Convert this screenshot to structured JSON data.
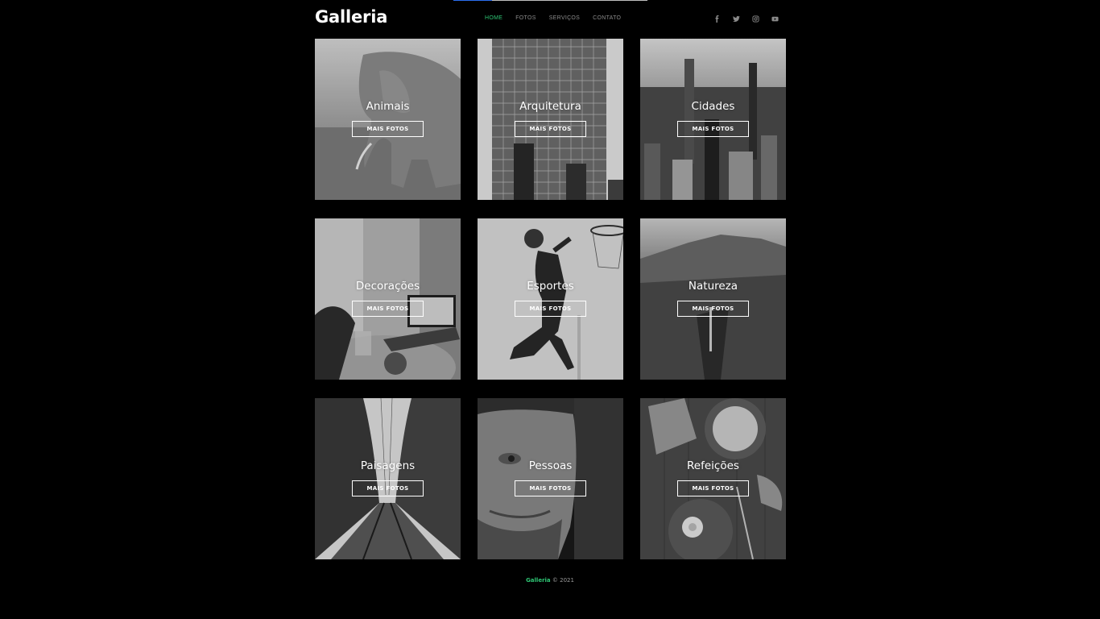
{
  "loading": {
    "progress": 0.2
  },
  "header": {
    "logo": "Galleria",
    "nav": [
      {
        "label": "HOME",
        "active": true
      },
      {
        "label": "FOTOS",
        "active": false
      },
      {
        "label": "SERVIÇOS",
        "active": false
      },
      {
        "label": "CONTATO",
        "active": false
      }
    ],
    "social": [
      "facebook-icon",
      "twitter-icon",
      "instagram-icon",
      "youtube-icon"
    ]
  },
  "gallery": [
    {
      "title": "Animais",
      "button": "MAIS FOTOS"
    },
    {
      "title": "Arquitetura",
      "button": "MAIS FOTOS"
    },
    {
      "title": "Cidades",
      "button": "MAIS FOTOS"
    },
    {
      "title": "Decorações",
      "button": "MAIS FOTOS"
    },
    {
      "title": "Esportes",
      "button": "MAIS FOTOS"
    },
    {
      "title": "Natureza",
      "button": "MAIS FOTOS"
    },
    {
      "title": "Paisagens",
      "button": "MAIS FOTOS"
    },
    {
      "title": "Pessoas",
      "button": "MAIS FOTOS"
    },
    {
      "title": "Refeições",
      "button": "MAIS FOTOS"
    }
  ],
  "footer": {
    "brand": "Galleria",
    "copyright": "© 2021"
  },
  "colors": {
    "accent": "#2ec574",
    "background": "#000000",
    "loadbar": "#2b6ef0"
  }
}
